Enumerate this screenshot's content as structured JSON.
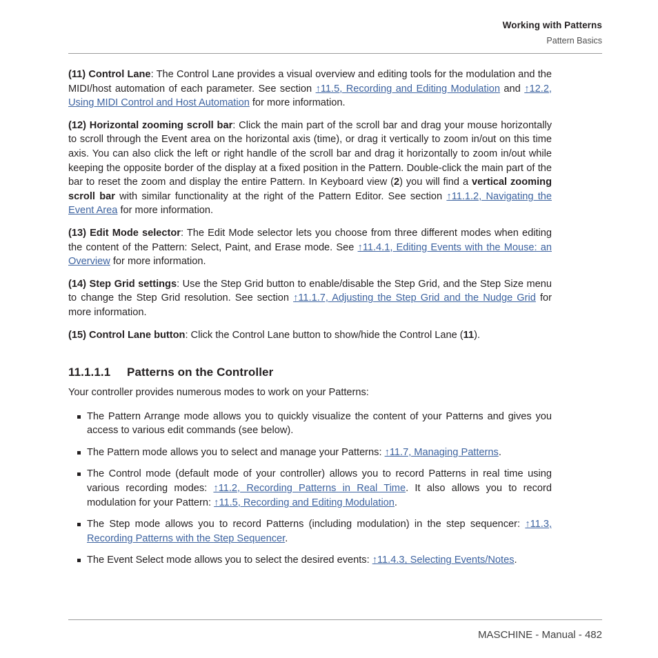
{
  "header": {
    "title": "Working with Patterns",
    "subtitle": "Pattern Basics"
  },
  "paragraphs": {
    "p11": {
      "number": "(11)",
      "term": "Control Lane",
      "text_1": ": The Control Lane provides a visual overview and editing tools for the modulation and the MIDI/host automation of each parameter. See section ",
      "link_1": "↑11.5, Recording and Editing Modulation",
      "text_2": " and ",
      "link_2": "↑12.2, Using MIDI Control and Host Automation",
      "text_3": " for more information."
    },
    "p12": {
      "number": "(12)",
      "term": "Horizontal zooming scroll bar",
      "text_1": ": Click the main part of the scroll bar and drag your mouse horizontally to scroll through the Event area on the horizontal axis (time), or drag it vertically to zoom in/out on this time axis. You can also click the left or right handle of the scroll bar and drag it horizontally to zoom in/out while keeping the opposite border of the display at a fixed position in the Pattern. Double-click the main part of the bar to reset the zoom and display the entire Pattern. In Keyboard view (",
      "ref_bold": "2",
      "text_2": ") you will find a ",
      "term_2": "vertical zooming scroll bar",
      "text_3": " with similar functionality at the right of the Pattern Editor. See section ",
      "link_1": "↑11.1.2, Navigating the Event Area",
      "text_4": " for more information."
    },
    "p13": {
      "number": "(13)",
      "term": "Edit Mode selector",
      "text_1": ": The Edit Mode selector lets you choose from three different modes when editing the content of the Pattern: Select, Paint, and Erase mode. See ",
      "link_1": "↑11.4.1, Editing Events with the Mouse: an Overview",
      "text_2": " for more information."
    },
    "p14": {
      "number": "(14)",
      "term": "Step Grid settings",
      "text_1": ": Use the Step Grid button to enable/disable the Step Grid, and the Step Size menu to change the Step Grid resolution. See section ",
      "link_1": "↑11.1.7, Adjusting the Step Grid and the Nudge Grid",
      "text_2": " for more information."
    },
    "p15": {
      "number": "(15)",
      "term": "Control Lane button",
      "text_1": ": Click the Control Lane button to show/hide the Control Lane (",
      "ref_bold": "11",
      "text_2": ")."
    }
  },
  "section": {
    "number": "11.1.1.1",
    "title": "Patterns on the Controller",
    "intro": "Your controller provides numerous modes to work on your Patterns:"
  },
  "mode_list": {
    "item_1": {
      "text_1": "The Pattern Arrange mode allows you to quickly visualize the content of your Patterns and gives you access to various edit commands (see below)."
    },
    "item_2": {
      "text_1": "The Pattern mode allows you to select and manage your Patterns: ",
      "link_1": "↑11.7, Managing Patterns",
      "text_2": "."
    },
    "item_3": {
      "text_1": "The Control mode (default mode of your controller) allows you to record Patterns in real time using various recording modes: ",
      "link_1": "↑11.2, Recording Patterns in Real Time",
      "text_2": ". It also allows you to record modulation for your Pattern: ",
      "link_2": "↑11.5, Recording and Editing Modulation",
      "text_3": "."
    },
    "item_4": {
      "text_1": "The Step mode allows you to record Patterns (including modulation) in the step sequencer: ",
      "link_1": "↑11.3, Recording Patterns with the Step Sequencer",
      "text_2": "."
    },
    "item_5": {
      "text_1": "The Event Select mode allows you to select the desired events: ",
      "link_1": "↑11.4.3, Selecting Events/Notes",
      "text_2": "."
    }
  },
  "footer": {
    "text": "MASCHINE - Manual - 482"
  },
  "colors": {
    "link": "#3d63a0",
    "text": "#231f20",
    "rule": "#9a9a9a"
  }
}
